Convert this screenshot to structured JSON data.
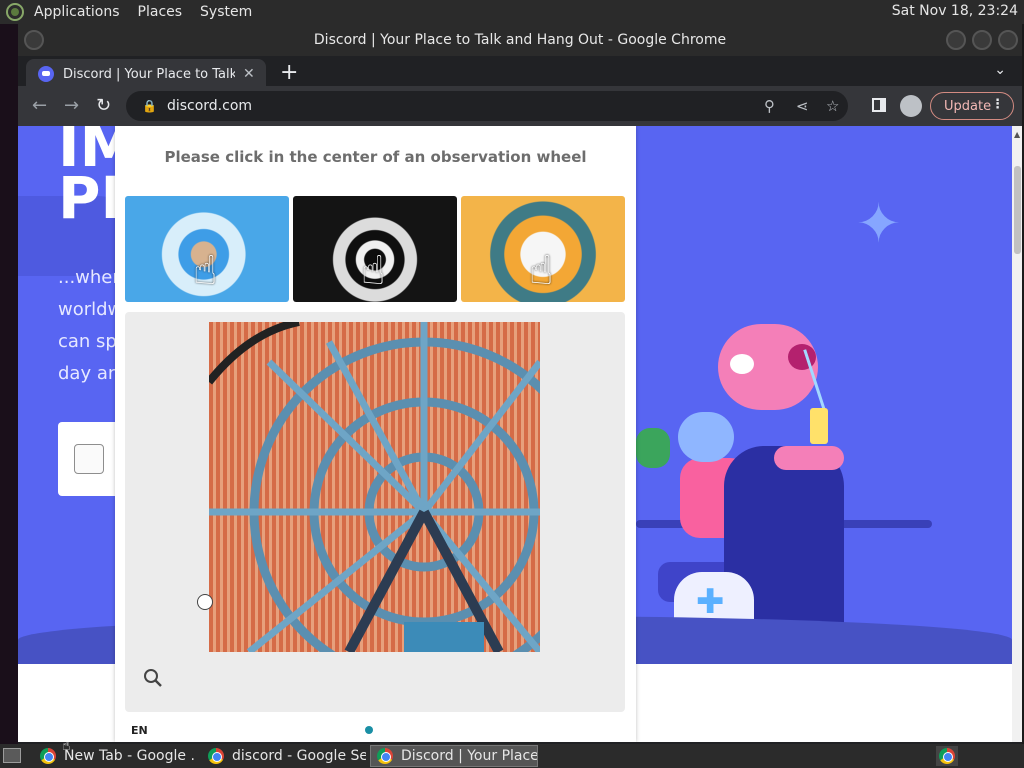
{
  "desktop": {
    "menus": [
      "Applications",
      "Places",
      "System"
    ],
    "clock": "Sat Nov 18, 23:24"
  },
  "window": {
    "title": "Discord | Your Place to Talk and Hang Out - Google Chrome"
  },
  "browser": {
    "tab_title": "Discord | Your Place to Talk and Hang Out",
    "url": "discord.com",
    "update_label": "Update"
  },
  "hero": {
    "headline_line1": "IM",
    "headline_line2": "PL",
    "para_lines": [
      "...wher",
      "worldw",
      "can sp",
      "day an"
    ]
  },
  "captcha": {
    "prompt": "Please click in the center of an observation wheel",
    "language": "EN"
  },
  "taskbar": {
    "items": [
      {
        "label": "New Tab - Google ..."
      },
      {
        "label": "discord - Google Se..."
      },
      {
        "label": "Discord | Your Place ..."
      }
    ]
  },
  "colors": {
    "discord_blurple": "#5865f2",
    "captcha_progress": "#1a8fa5"
  }
}
